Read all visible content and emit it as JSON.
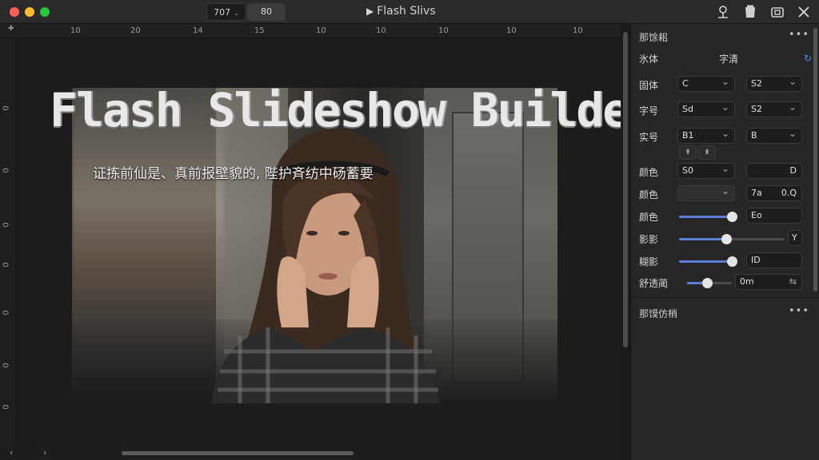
{
  "titlebar": {
    "seg_left": "707",
    "seg_right": "80",
    "title": "Flash Slivs",
    "icons": [
      "person-icon",
      "bucket-icon",
      "window-icon",
      "close-icon"
    ]
  },
  "ruler": {
    "top_ticks": [
      "10",
      "20",
      "14",
      "15",
      "10",
      "10",
      "10",
      "10",
      "10"
    ],
    "left_ticks": [
      "0",
      "0",
      "0",
      "0",
      "0",
      "0",
      "0",
      "0"
    ]
  },
  "slide": {
    "title": "Flash Slideshow Builder",
    "subtitle": "证拣前仙是、真前报壁貌的, 陛护斉纺中砀蓄要"
  },
  "inspector": {
    "section1_title": "那馀耜",
    "tabs": {
      "left": "氷体",
      "right": "字清"
    },
    "rows": [
      {
        "label": "固体",
        "a": "C",
        "b": "S2"
      },
      {
        "label": "字号",
        "a": "Sd",
        "b": "S2"
      },
      {
        "label": "实号",
        "a": "B1",
        "b": "B"
      }
    ],
    "align_buttons": [
      "⇞",
      "⇟"
    ],
    "color_rows": [
      {
        "label": "颜色",
        "a": "S0",
        "b": "D"
      },
      {
        "label": "颜色",
        "a": "",
        "b1": "7a",
        "b2": "0.Q"
      }
    ],
    "slider_rows": [
      {
        "label": "颜色",
        "value": 0.92,
        "field": "Eo"
      },
      {
        "label": "影影",
        "value": 0.45,
        "field": "Y"
      },
      {
        "label": "糊影",
        "value": 0.92,
        "field": "ID"
      },
      {
        "label": "舒透蔺",
        "value": 0.45,
        "field": "0m"
      }
    ],
    "section2_title": "那馍仿梢"
  },
  "colors": {
    "accent": "#5b7fd6",
    "link": "#4a8ee8"
  }
}
